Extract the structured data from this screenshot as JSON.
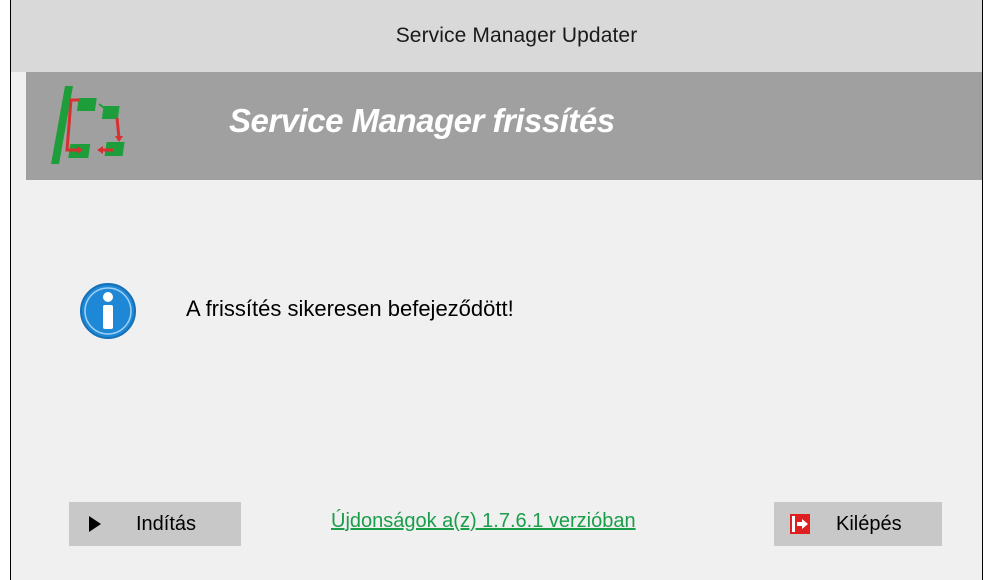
{
  "window": {
    "title": "Service Manager Updater"
  },
  "banner": {
    "title": "Service Manager frissítés",
    "logo_icon": "service-manager-workflow-logo"
  },
  "content": {
    "message_icon": "info-icon",
    "message": "A frissítés sikeresen befejeződött!"
  },
  "footer": {
    "start_label": "Indítás",
    "start_icon": "play-triangle-icon",
    "news_link": "Újdonságok a(z) 1.7.6.1 verzióban",
    "exit_label": "Kilépés",
    "exit_icon": "exit-door-icon"
  },
  "colors": {
    "titlebar": "#d9d9d9",
    "banner": "#a0a0a0",
    "window_bg": "#f0f0f0",
    "button_bg": "#c8c8c8",
    "link": "#1a9e4a",
    "info_icon": "#1e88d6",
    "exit_icon": "#e02020",
    "logo_green": "#1e9e3a"
  }
}
